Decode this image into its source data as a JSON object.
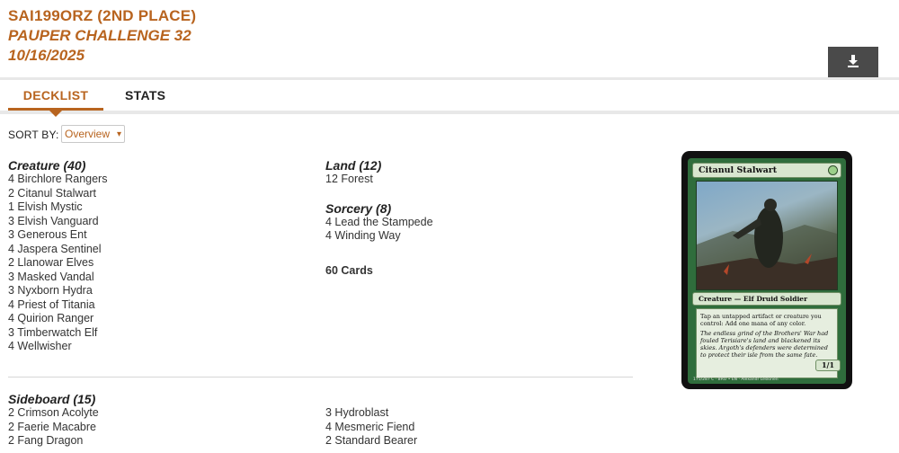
{
  "header": {
    "player": "SAI199ORZ (2ND PLACE)",
    "event": "PAUPER CHALLENGE 32",
    "date": "10/16/2025"
  },
  "download_icon": "download-icon",
  "tabs": [
    {
      "label": "DECKLIST",
      "active": true
    },
    {
      "label": "STATS",
      "active": false
    }
  ],
  "sort": {
    "label": "SORT BY:",
    "selected": "Overview"
  },
  "mainboard": {
    "creature": {
      "heading": "Creature (40)",
      "cards": [
        "4 Birchlore Rangers",
        "2 Citanul Stalwart",
        "1 Elvish Mystic",
        "3 Elvish Vanguard",
        "3 Generous Ent",
        "4 Jaspera Sentinel",
        "2 Llanowar Elves",
        "3 Masked Vandal",
        "3 Nyxborn Hydra",
        "4 Priest of Titania",
        "4 Quirion Ranger",
        "3 Timberwatch Elf",
        "4 Wellwisher"
      ]
    },
    "land": {
      "heading": "Land (12)",
      "cards": [
        "12 Forest"
      ]
    },
    "sorcery": {
      "heading": "Sorcery (8)",
      "cards": [
        "4 Lead the Stampede",
        "4 Winding Way"
      ]
    },
    "total": "60 Cards"
  },
  "sideboard": {
    "heading": "Sideboard (15)",
    "col1": [
      "2 Crimson Acolyte",
      "2 Faerie Macabre",
      "2 Fang Dragon"
    ],
    "col2": [
      "3 Hydroblast",
      "4 Mesmeric Fiend",
      "2 Standard Bearer"
    ]
  },
  "card_preview": {
    "name": "Citanul Stalwart",
    "type_line": "Creature — Elf Druid Soldier",
    "rules": "Tap an untapped artifact or creature you control: Add one mana of any color.",
    "flavor": "The endless grind of the Brothers' War had fouled Terisiare's land and blackened its skies. Argoth's defenders were determined to protect their isle from the same fate.",
    "pt": "1/1",
    "footer": "175/287 C · BRO • EN · Alexandr Leskinen",
    "colors": {
      "frame": "#2f6d3c",
      "border": "#111111"
    }
  },
  "colors": {
    "accent": "#b8641f",
    "button": "#4a4a4a"
  }
}
